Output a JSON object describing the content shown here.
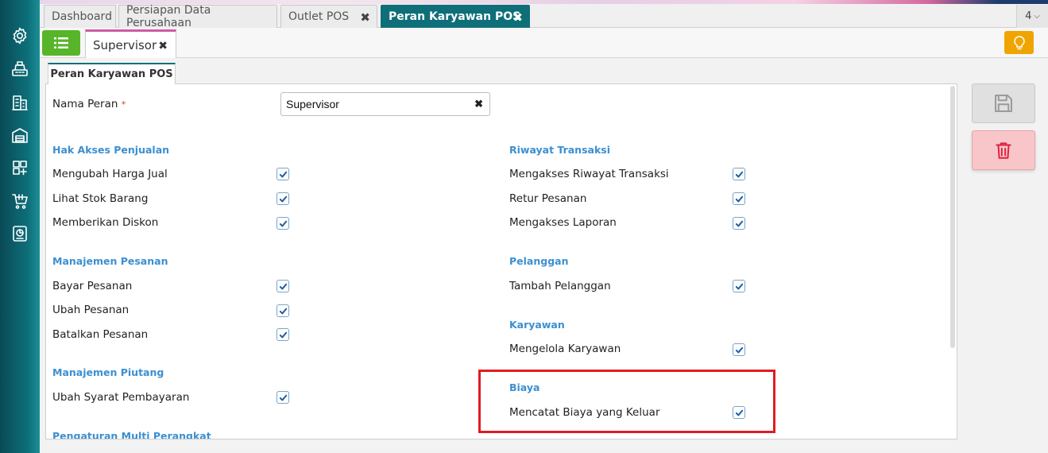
{
  "sidebar": {
    "items": [
      {
        "icon": "gear-icon"
      },
      {
        "icon": "cash-register-icon"
      },
      {
        "icon": "building-icon"
      },
      {
        "icon": "warehouse-icon"
      },
      {
        "icon": "inventory-icon"
      },
      {
        "icon": "cart-icon"
      },
      {
        "icon": "report-icon"
      }
    ]
  },
  "tabs": [
    {
      "label": "Dashboard"
    },
    {
      "label": "Persiapan Data Perusahaan"
    },
    {
      "label": "Outlet POS"
    },
    {
      "label": "Peran Karyawan POS"
    }
  ],
  "tab_count": "4",
  "subtab": {
    "label": "Supervisor"
  },
  "form_tab": "Peran Karyawan POS",
  "form": {
    "role_label": "Nama Peran",
    "required_mark": "*",
    "role_value": "Supervisor"
  },
  "left_sections": [
    {
      "title": "Hak Akses Penjualan",
      "items": [
        {
          "label": "Mengubah Harga Jual",
          "checked": true
        },
        {
          "label": "Lihat Stok Barang",
          "checked": true
        },
        {
          "label": "Memberikan Diskon",
          "checked": true
        }
      ]
    },
    {
      "title": "Manajemen Pesanan",
      "items": [
        {
          "label": "Bayar Pesanan",
          "checked": true
        },
        {
          "label": "Ubah Pesanan",
          "checked": true
        },
        {
          "label": "Batalkan Pesanan",
          "checked": true
        }
      ]
    },
    {
      "title": "Manajemen Piutang",
      "items": [
        {
          "label": "Ubah Syarat Pembayaran",
          "checked": true
        }
      ]
    },
    {
      "title": "Pengaturan Multi Perangkat",
      "items": []
    }
  ],
  "right_sections": [
    {
      "title": "Riwayat Transaksi",
      "items": [
        {
          "label": "Mengakses Riwayat Transaksi",
          "checked": true
        },
        {
          "label": "Retur Pesanan",
          "checked": true
        },
        {
          "label": "Mengakses Laporan",
          "checked": true
        }
      ]
    },
    {
      "title": "Pelanggan",
      "items": [
        {
          "label": "Tambah Pelanggan",
          "checked": true
        }
      ]
    },
    {
      "title": "Karyawan",
      "items": [
        {
          "label": "Mengelola Karyawan",
          "checked": true
        }
      ]
    },
    {
      "title": "Biaya",
      "items": [
        {
          "label": "Mencatat Biaya yang Keluar",
          "checked": true
        }
      ]
    }
  ],
  "colors": {
    "sidebar": "#0d6f7a",
    "active_tab": "#0f6f79",
    "section_title": "#3b8fd1",
    "menu_button": "#58b52a",
    "bulb_button": "#f0a400",
    "highlight_box": "#e01c23",
    "delete_button": "#f8c6c9"
  },
  "actions": {
    "save_icon": "save-icon",
    "delete_icon": "trash-icon"
  }
}
